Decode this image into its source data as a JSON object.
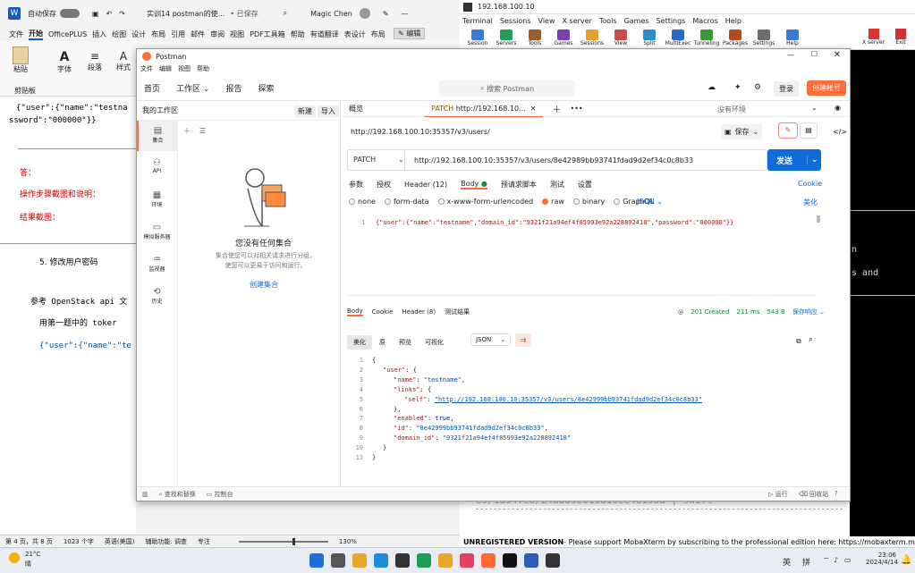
{
  "word": {
    "autosave": "自动保存",
    "doc_title": "实训14 postman的使...",
    "saved": "• 已保存",
    "user": "Magic Chen",
    "menu": [
      "文件",
      "开始",
      "OfficePLUS",
      "插入",
      "绘图",
      "设计",
      "布局",
      "引用",
      "邮件",
      "审阅",
      "视图",
      "PDF工具箱",
      "帮助",
      "有道翻译",
      "表设计",
      "布局"
    ],
    "edit_btn": "编辑",
    "ribbon_groups": [
      "粘贴",
      "字体",
      "段落",
      "样式"
    ],
    "clipboard_label": "剪贴板",
    "doc_lines": [
      "{\"user\":{\"name\":\"testna",
      "ssword\":\"000000\"}}",
      "答：",
      "操作步骤截图和说明：",
      "结果截图：",
      "5. 修改用户密码",
      "参考 OpenStack api 文",
      "用第一题中的 toker",
      "{\"user\":{\"name\":\"te"
    ],
    "status": {
      "page": "第 4 页，共 8 页",
      "words": "1023 个字",
      "lang": "英语(美国)",
      "accessibility": "辅助功能: 调查",
      "focus": "专注",
      "zoom": "130%"
    }
  },
  "moba": {
    "title": "192.168.100.10",
    "menu": [
      "Terminal",
      "Sessions",
      "View",
      "X server",
      "Tools",
      "Games",
      "Settings",
      "Macros",
      "Help"
    ],
    "tools": [
      "Session",
      "Servers",
      "Tools",
      "Games",
      "Sessions",
      "View",
      "Split",
      "MultiExec",
      "Tunneling",
      "Packages",
      "Settings",
      "Help"
    ],
    "right_tools": [
      "X server",
      "Exit"
    ],
    "term_lines": [
      "in",
      "ts and"
    ],
    "bottom_row": "e5/1a54fe8/24ab89e019d10ee46153d | swift",
    "prompt": "[root@controller ~]# ",
    "unregistered": "UNREGISTERED VERSION",
    "unregistered_msg": " -  Please support MobaXterm by subscribing to the professional edition here:  https://mobaxterm.mobatek."
  },
  "postman": {
    "title": "Postman",
    "menu": [
      "文件",
      "编辑",
      "视图",
      "帮助"
    ],
    "nav": [
      "首页",
      "工作区",
      "报告",
      "探索"
    ],
    "search_placeholder": "搜索 Postman",
    "login": "登录",
    "signup": "创建帐号",
    "sidebar": {
      "heading": "我的工作区",
      "new_btn": "新建",
      "import_btn": "导入",
      "items": [
        {
          "label": "集合",
          "icon": "collections-icon"
        },
        {
          "label": "API",
          "icon": "api-icon"
        },
        {
          "label": "环境",
          "icon": "environments-icon"
        },
        {
          "label": "模拟服务器",
          "icon": "mock-servers-icon"
        },
        {
          "label": "监视器",
          "icon": "monitors-icon"
        },
        {
          "label": "历史",
          "icon": "history-icon"
        }
      ],
      "empty_title": "您没有任何集合",
      "empty_desc": "集合使您可以对相关请求进行分组，使您可以更易于访问和运行。",
      "create_link": "创建集合"
    },
    "tabs": [
      {
        "label": "概览",
        "method": ""
      },
      {
        "label": "http://192.168.10...",
        "method": "PATCH"
      }
    ],
    "env": "没有环境",
    "request_name": "http://192.168.100.10:35357/v3/users/",
    "save": "保存",
    "method": "PATCH",
    "url": "http://192.168.100.10:35357/v3/users/8e42989bb93741fdad9d2ef34c0c8b33",
    "send": "发送",
    "req_tabs": [
      "参数",
      "授权",
      "Header (12)",
      "Body",
      "预请求脚本",
      "测试",
      "设置"
    ],
    "cookie": "Cookie",
    "body_types": [
      "none",
      "form-data",
      "x-www-form-urlencoded",
      "raw",
      "binary",
      "GraphQL"
    ],
    "body_selected": "raw",
    "json_label": "JSON",
    "beautify": "美化",
    "request_body": "{\"user\":{\"name\":\"testname\",\"domain_id\":\"9321f21a94ef4f85993e92a228892418\",\"password\":\"000000\"}}",
    "resp_tabs": [
      "Body",
      "Cookie",
      "Header (8)",
      "测试结果"
    ],
    "resp_status": "201 Created",
    "resp_time": "211 ms",
    "resp_size": "543 B",
    "save_resp": "保存响应",
    "view_tabs": [
      "美化",
      "原",
      "预览",
      "可视化"
    ],
    "resp_format": "JSON",
    "resp_lines": [
      {
        "n": "1",
        "ind": 0,
        "parts": [
          [
            "p",
            "{"
          ]
        ]
      },
      {
        "n": "2",
        "ind": 1,
        "parts": [
          [
            "k",
            "\"user\""
          ],
          [
            "p",
            ": {"
          ]
        ]
      },
      {
        "n": "3",
        "ind": 2,
        "parts": [
          [
            "k",
            "\"name\""
          ],
          [
            "p",
            ": "
          ],
          [
            "s",
            "\"testname\""
          ],
          [
            "p",
            ","
          ]
        ]
      },
      {
        "n": "4",
        "ind": 2,
        "parts": [
          [
            "k",
            "\"links\""
          ],
          [
            "p",
            ": {"
          ]
        ]
      },
      {
        "n": "5",
        "ind": 3,
        "parts": [
          [
            "k",
            "\"self\""
          ],
          [
            "p",
            ": "
          ],
          [
            "l",
            "\"http://192.168.100.10:35357/v3/users/8e42999bb93741fdad9d2ef34c0c8b33\""
          ]
        ]
      },
      {
        "n": "6",
        "ind": 2,
        "parts": [
          [
            "p",
            "},"
          ]
        ]
      },
      {
        "n": "7",
        "ind": 2,
        "parts": [
          [
            "k",
            "\"enabled\""
          ],
          [
            "p",
            ": "
          ],
          [
            "b",
            "true"
          ],
          [
            "p",
            ","
          ]
        ]
      },
      {
        "n": "8",
        "ind": 2,
        "parts": [
          [
            "k",
            "\"id\""
          ],
          [
            "p",
            ": "
          ],
          [
            "s",
            "\"8e42999bb93741fdad9d2ef34c0c8b33\""
          ],
          [
            "p",
            ","
          ]
        ]
      },
      {
        "n": "9",
        "ind": 2,
        "parts": [
          [
            "k",
            "\"domain_id\""
          ],
          [
            "p",
            ": "
          ],
          [
            "s",
            "\"9321f21a94ef4f85993e92a228892418\""
          ]
        ]
      },
      {
        "n": "10",
        "ind": 1,
        "parts": [
          [
            "p",
            "}"
          ]
        ]
      },
      {
        "n": "11",
        "ind": 0,
        "parts": [
          [
            "p",
            "}"
          ]
        ]
      }
    ],
    "footer": {
      "find": "查找和替换",
      "console": "控制台",
      "runner": "运行",
      "trash": "回收站"
    }
  },
  "taskbar": {
    "temp": "21°C",
    "weather": "晴",
    "ime1": "英",
    "ime2": "拼",
    "time": "23:06",
    "date": "2024/4/14"
  }
}
